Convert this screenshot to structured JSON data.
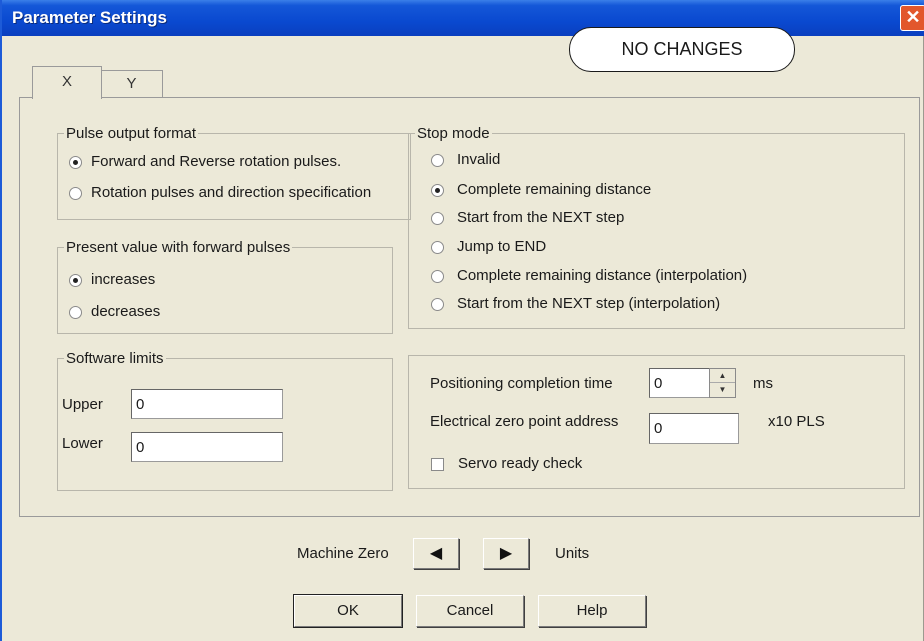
{
  "window": {
    "title": "Parameter Settings",
    "close": "✕"
  },
  "callout": "NO CHANGES",
  "tabs": [
    {
      "label": "X",
      "selected": true
    },
    {
      "label": "Y",
      "selected": false
    }
  ],
  "pulse_output": {
    "legend": "Pulse output format",
    "options": [
      {
        "label": "Forward and Reverse rotation pulses.",
        "selected": true
      },
      {
        "label": "Rotation pulses and direction specification",
        "selected": false
      }
    ]
  },
  "present_value": {
    "legend": "Present value with forward pulses",
    "options": [
      {
        "label": "increases",
        "selected": true
      },
      {
        "label": "decreases",
        "selected": false
      }
    ]
  },
  "software_limits": {
    "legend": "Software limits",
    "upper_label": "Upper",
    "upper_value": "0",
    "lower_label": "Lower",
    "lower_value": "0"
  },
  "stop_mode": {
    "legend": "Stop mode",
    "options": [
      {
        "label": "Invalid",
        "selected": false
      },
      {
        "label": "Complete remaining distance",
        "selected": true
      },
      {
        "label": "Start from the NEXT step",
        "selected": false
      },
      {
        "label": "Jump to END",
        "selected": false
      },
      {
        "label": "Complete remaining distance (interpolation)",
        "selected": false
      },
      {
        "label": "Start from the NEXT step (interpolation)",
        "selected": false
      }
    ]
  },
  "positioning": {
    "completion_label": "Positioning completion time",
    "completion_value": "0",
    "completion_unit": "ms",
    "zero_label": "Electrical zero point address",
    "zero_value": "0",
    "zero_unit": "x10 PLS",
    "servo_label": "Servo ready check",
    "servo_checked": false
  },
  "machine_zero": {
    "label": "Machine Zero",
    "left_icon": "arrow-left",
    "right_icon": "arrow-right",
    "units_label": "Units"
  },
  "buttons": {
    "ok": "OK",
    "cancel": "Cancel",
    "help": "Help"
  },
  "colors": {
    "titlebar": "#0a49d0",
    "close": "#e2572c",
    "face": "#ece9d8"
  }
}
